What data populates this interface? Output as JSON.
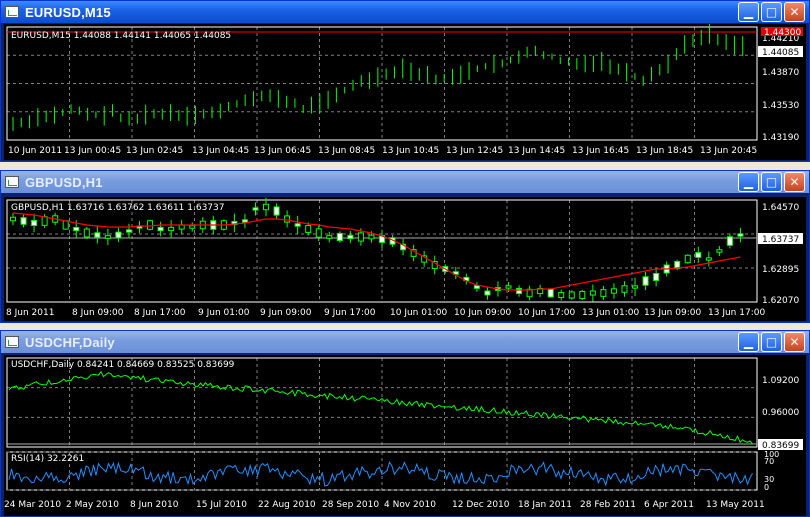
{
  "windows": [
    {
      "title": "EURUSD,M15",
      "info": "EURUSD,M15  1.44088 1.44141 1.44065 1.44085",
      "price_labels": [
        "1.44210",
        "1.43870",
        "1.43530",
        "1.43190"
      ],
      "red_tag": "1.44300",
      "current_tag": "1.44085",
      "time_labels": [
        "10 Jun 2011",
        "13 Jun 00:45",
        "13 Jun 02:45",
        "13 Jun 04:45",
        "13 Jun 06:45",
        "13 Jun 08:45",
        "13 Jun 10:45",
        "13 Jun 12:45",
        "13 Jun 14:45",
        "13 Jun 16:45",
        "13 Jun 18:45",
        "13 Jun 20:45"
      ]
    },
    {
      "title": "GBPUSD,H1",
      "info": "GBPUSD,H1  1.63716 1.63762 1.63611 1.63737",
      "price_labels": [
        "1.64570",
        "1.63737",
        "1.62895",
        "1.62070"
      ],
      "time_labels": [
        "8 Jun 2011",
        "8 Jun 09:00",
        "8 Jun 17:00",
        "9 Jun 01:00",
        "9 Jun 09:00",
        "9 Jun 17:00",
        "10 Jun 01:00",
        "10 Jun 09:00",
        "10 Jun 17:00",
        "13 Jun 01:00",
        "13 Jun 09:00",
        "13 Jun 17:00"
      ]
    },
    {
      "title": "USDCHF,Daily",
      "info": "USDCHF,Daily  0.84241 0.84669 0.83525 0.83699",
      "price_labels": [
        "1.09200",
        "0.96000",
        "0.83699"
      ],
      "rsi_label": "RSI(14) 32.2261",
      "rsi_levels": [
        "100",
        "70",
        "30",
        "0"
      ],
      "time_labels": [
        "24 Mar 2010",
        "2 May 2010",
        "8 Jun 2010",
        "15 Jul 2010",
        "22 Aug 2010",
        "28 Sep 2010",
        "4 Nov 2010",
        "12 Dec 2010",
        "18 Jan 2011",
        "28 Feb 2011",
        "6 Apr 2011",
        "13 May 2011"
      ]
    }
  ],
  "colors": {
    "candle": "#00ff00",
    "ma": "#ff0000",
    "rsi": "#1e90ff",
    "grid": "#7f7f7f",
    "text": "#ffffff"
  },
  "icons": {
    "app": "chart-window-icon",
    "minimize": "minimize-icon",
    "maximize": "maximize-icon",
    "close": "close-icon"
  },
  "buttons": {
    "minimize": "▁",
    "maximize": "□",
    "close": "✕"
  }
}
